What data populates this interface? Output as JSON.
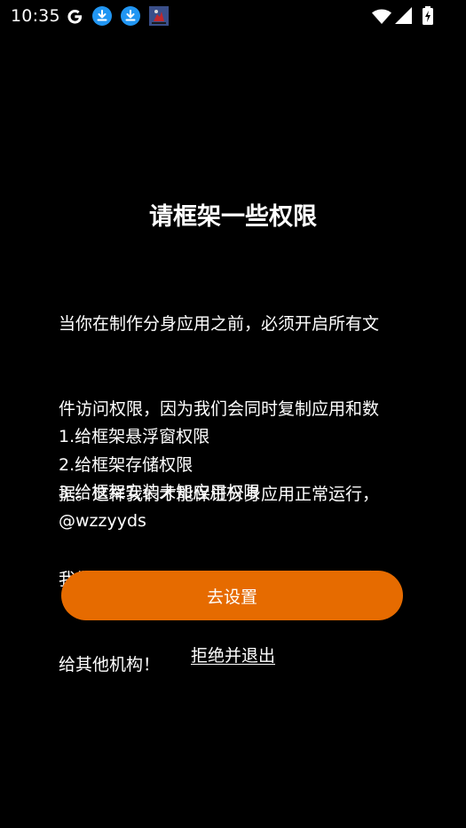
{
  "status_bar": {
    "time": "10:35",
    "icons": [
      "google-icon",
      "download-icon",
      "download-icon",
      "app-notification-icon",
      "wifi-icon",
      "signal-icon",
      "battery-charging-icon"
    ],
    "colors": {
      "download_badge": "#2196f3",
      "foreground": "#ffffff"
    }
  },
  "dialog": {
    "title": "请框架一些权限",
    "body_lines": [
      "当你在制作分身应用之前，必须开启所有文",
      "件访问权限，因为我们会同时复制应用和数",
      "据。这样我们才能保证分身应用正常运行，",
      "我们不会对您的数据进行收集，也不会分享",
      "给其他机构！"
    ],
    "list": [
      "1.给框架悬浮窗权限",
      "2.给框架存储权限",
      "3.给框架安装未知应用权限",
      "@wzzyyds"
    ],
    "primary_button_label": "去设置",
    "reject_label": "拒绝并退出"
  },
  "colors": {
    "background": "#000000",
    "accent": "#e66b00",
    "text": "#ffffff"
  }
}
